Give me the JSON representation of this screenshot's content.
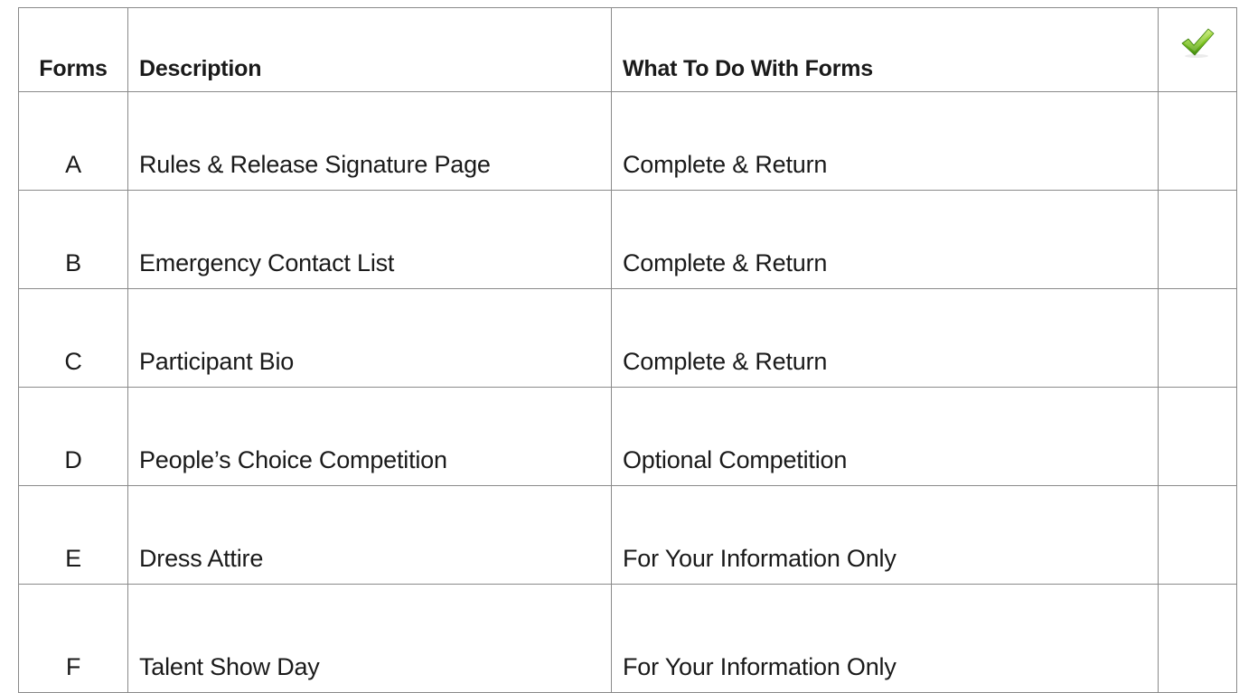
{
  "table": {
    "headers": {
      "forms": "Forms",
      "description": "Description",
      "action": "What To Do With Forms",
      "check_icon": "checkmark-icon"
    },
    "rows": [
      {
        "form": "A",
        "description": "Rules & Release Signature Page",
        "action": "Complete & Return"
      },
      {
        "form": "B",
        "description": "Emergency Contact List",
        "action": "Complete & Return"
      },
      {
        "form": "C",
        "description": "Participant Bio",
        "action": "Complete & Return"
      },
      {
        "form": "D",
        "description": "People’s Choice Competition",
        "action": "Optional Competition"
      },
      {
        "form": "E",
        "description": "Dress Attire",
        "action": "For Your Information Only"
      },
      {
        "form": "F",
        "description": "Talent Show Day",
        "action": "For Your Information Only"
      }
    ]
  },
  "colors": {
    "grid": "#8a8a8a",
    "text": "#1a1a1a",
    "check_light": "#b8e05a",
    "check_dark": "#4f9a12"
  }
}
